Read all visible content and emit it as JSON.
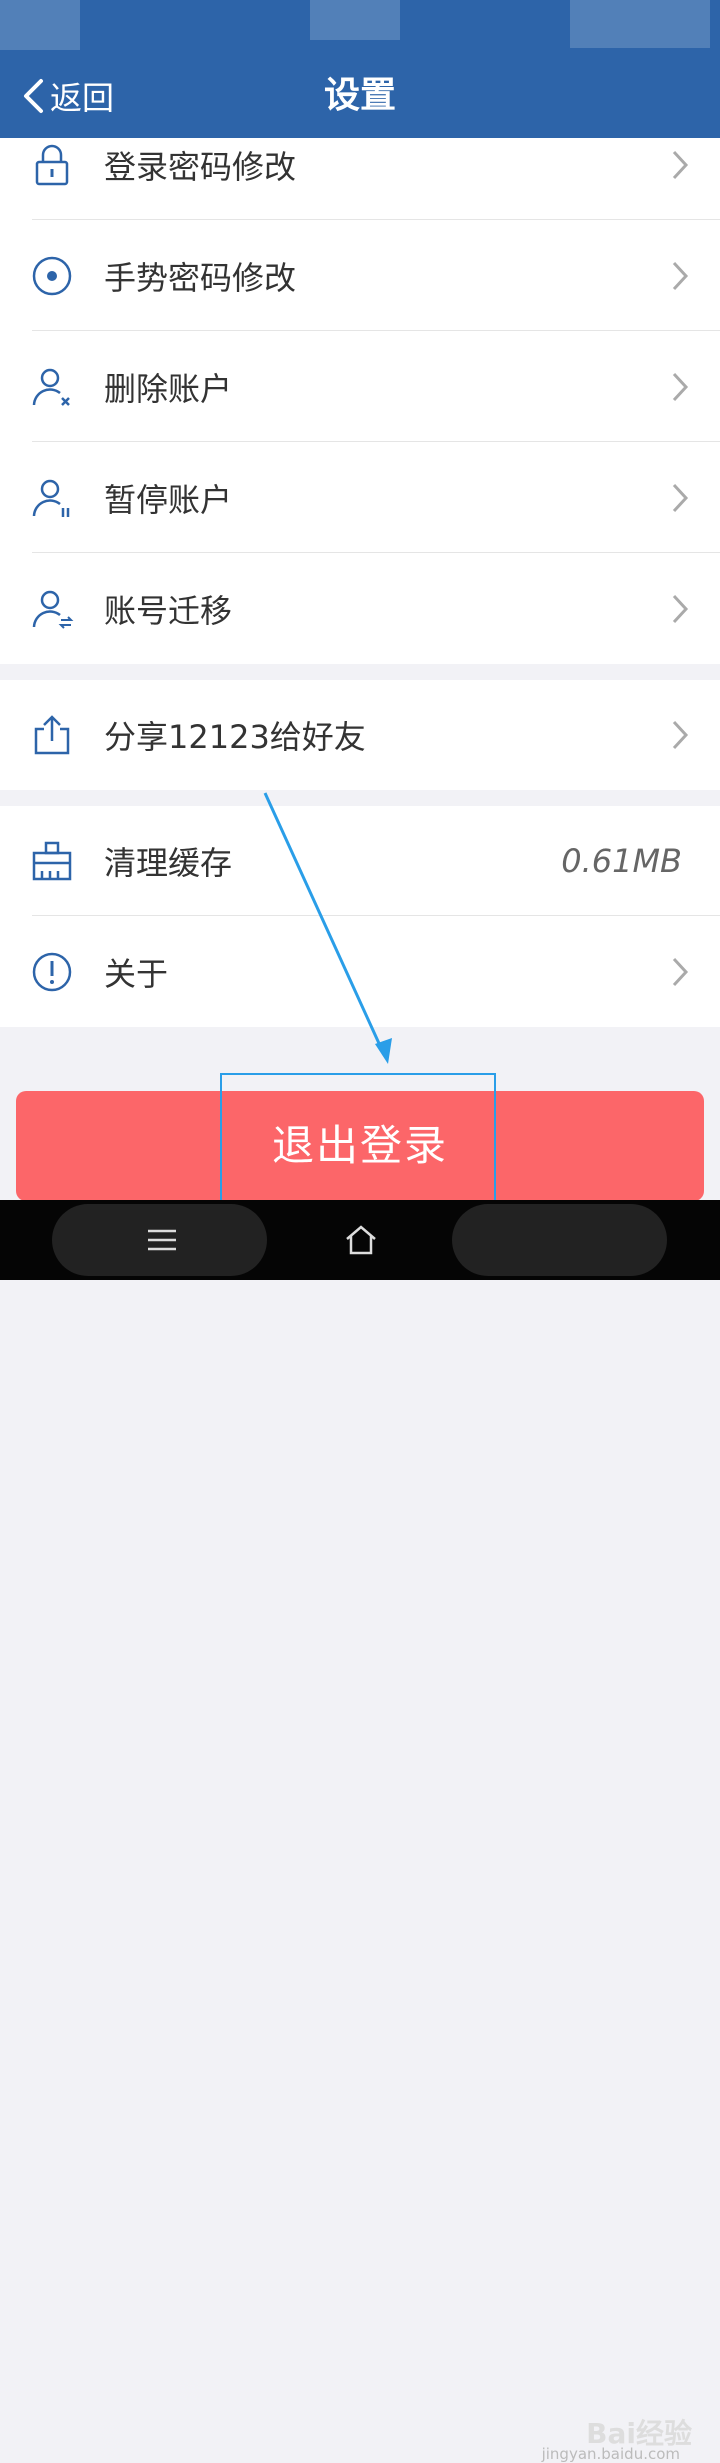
{
  "header": {
    "back_label": "返回",
    "title": "设置",
    "background_color": "#2d64a9"
  },
  "groups": [
    {
      "items": [
        {
          "label": "登录密码修改",
          "icon": "lock-icon",
          "trailing": "chevron"
        },
        {
          "label": "手势密码修改",
          "icon": "target-icon",
          "trailing": "chevron"
        },
        {
          "label": "删除账户",
          "icon": "user-remove-icon",
          "trailing": "chevron"
        },
        {
          "label": "暂停账户",
          "icon": "user-pause-icon",
          "trailing": "chevron"
        },
        {
          "label": "账号迁移",
          "icon": "user-transfer-icon",
          "trailing": "chevron"
        }
      ]
    },
    {
      "items": [
        {
          "label": "分享12123给好友",
          "icon": "share-icon",
          "trailing": "chevron"
        }
      ]
    },
    {
      "items": [
        {
          "label": "清理缓存",
          "icon": "broom-icon",
          "trailing": "value",
          "value": "0.61MB"
        },
        {
          "label": "关于",
          "icon": "info-icon",
          "trailing": "chevron"
        }
      ]
    }
  ],
  "logout_label": "退出登录",
  "logout_color": "#fc6669",
  "annotation": {
    "color": "#2a9ee8"
  },
  "watermark": {
    "brand": "Bai经验",
    "url": "jingyan.baidu.com"
  }
}
